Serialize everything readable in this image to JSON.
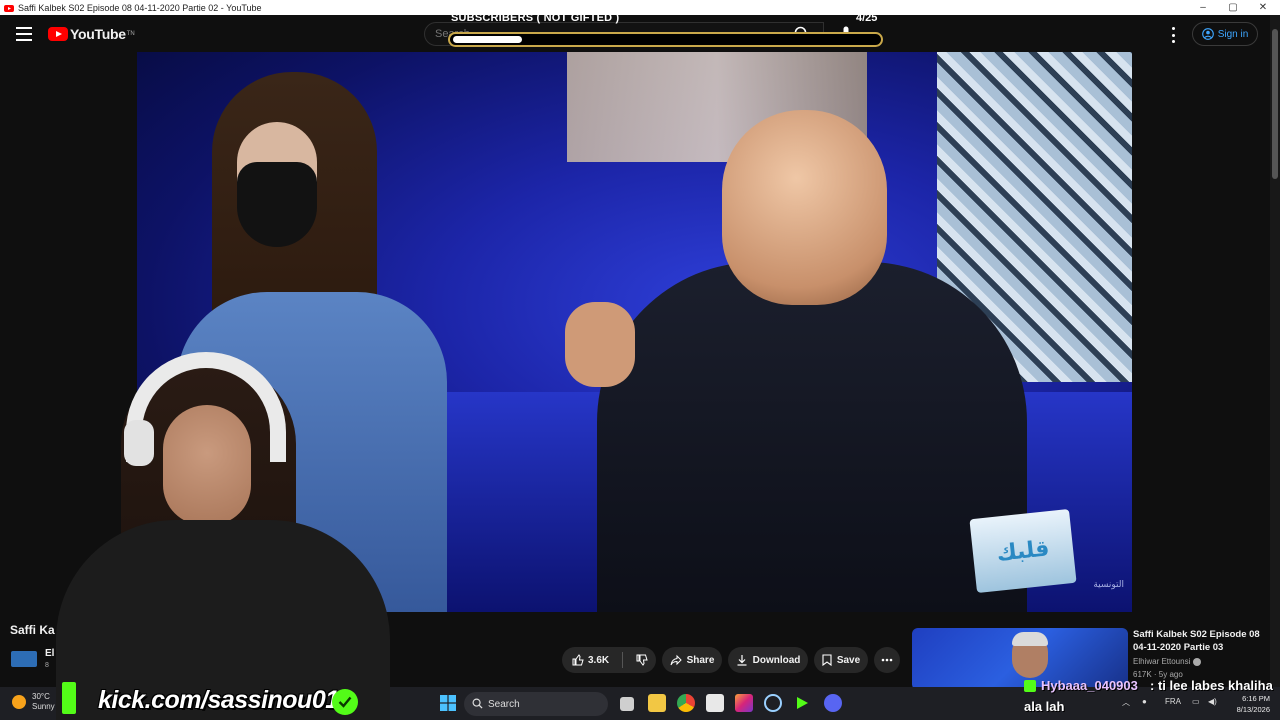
{
  "window": {
    "title": "Saffi Kalbek S02 Episode 08 04-11-2020 Partie 02 - YouTube",
    "controls": [
      "–",
      "▢",
      "✕"
    ]
  },
  "header": {
    "logo_text": "YouTube",
    "logo_sup": "TN",
    "search_placeholder": "Search",
    "sign_in_label": "Sign in"
  },
  "stream_overlay": {
    "subscribers_label": "SUBSCRIBERS ( NOT GIFTED )",
    "subscribers_count": "4/25",
    "progress_fraction": 0.16,
    "kick_url": "kick.com/sassinou01"
  },
  "video": {
    "title": "Saffi Kalbek S02 Episode 08 04-11-2020 Partie 02",
    "title_visible": "Saffi Ka",
    "channel_short": "El",
    "channel_subs_short": "8",
    "show_logo_text": "قلبك",
    "watermark": "التونسية"
  },
  "actions": {
    "like_count": "3.6K",
    "share_label": "Share",
    "download_label": "Download",
    "save_label": "Save"
  },
  "suggestion": {
    "title": "Saffi Kalbek S02 Episode 08 04-11-2020 Partie 03",
    "channel": "Elhiwar Ettounsi",
    "meta": "617K · 5y ago"
  },
  "chat": {
    "user": "Hybaaa_040903",
    "message": ": ti lee labes khaliha",
    "message_cont": "ala lah"
  },
  "taskbar": {
    "weather_temp": "30°C",
    "weather_desc": "Sunny",
    "search_label": "Search",
    "lang": "FRA",
    "time": "6:16 PM",
    "date": "8/13/2026"
  },
  "colors": {
    "accent_red": "#ff0000",
    "link_blue": "#3ea6ff",
    "kick_green": "#53fc18",
    "progress_border": "#c9a84a"
  }
}
